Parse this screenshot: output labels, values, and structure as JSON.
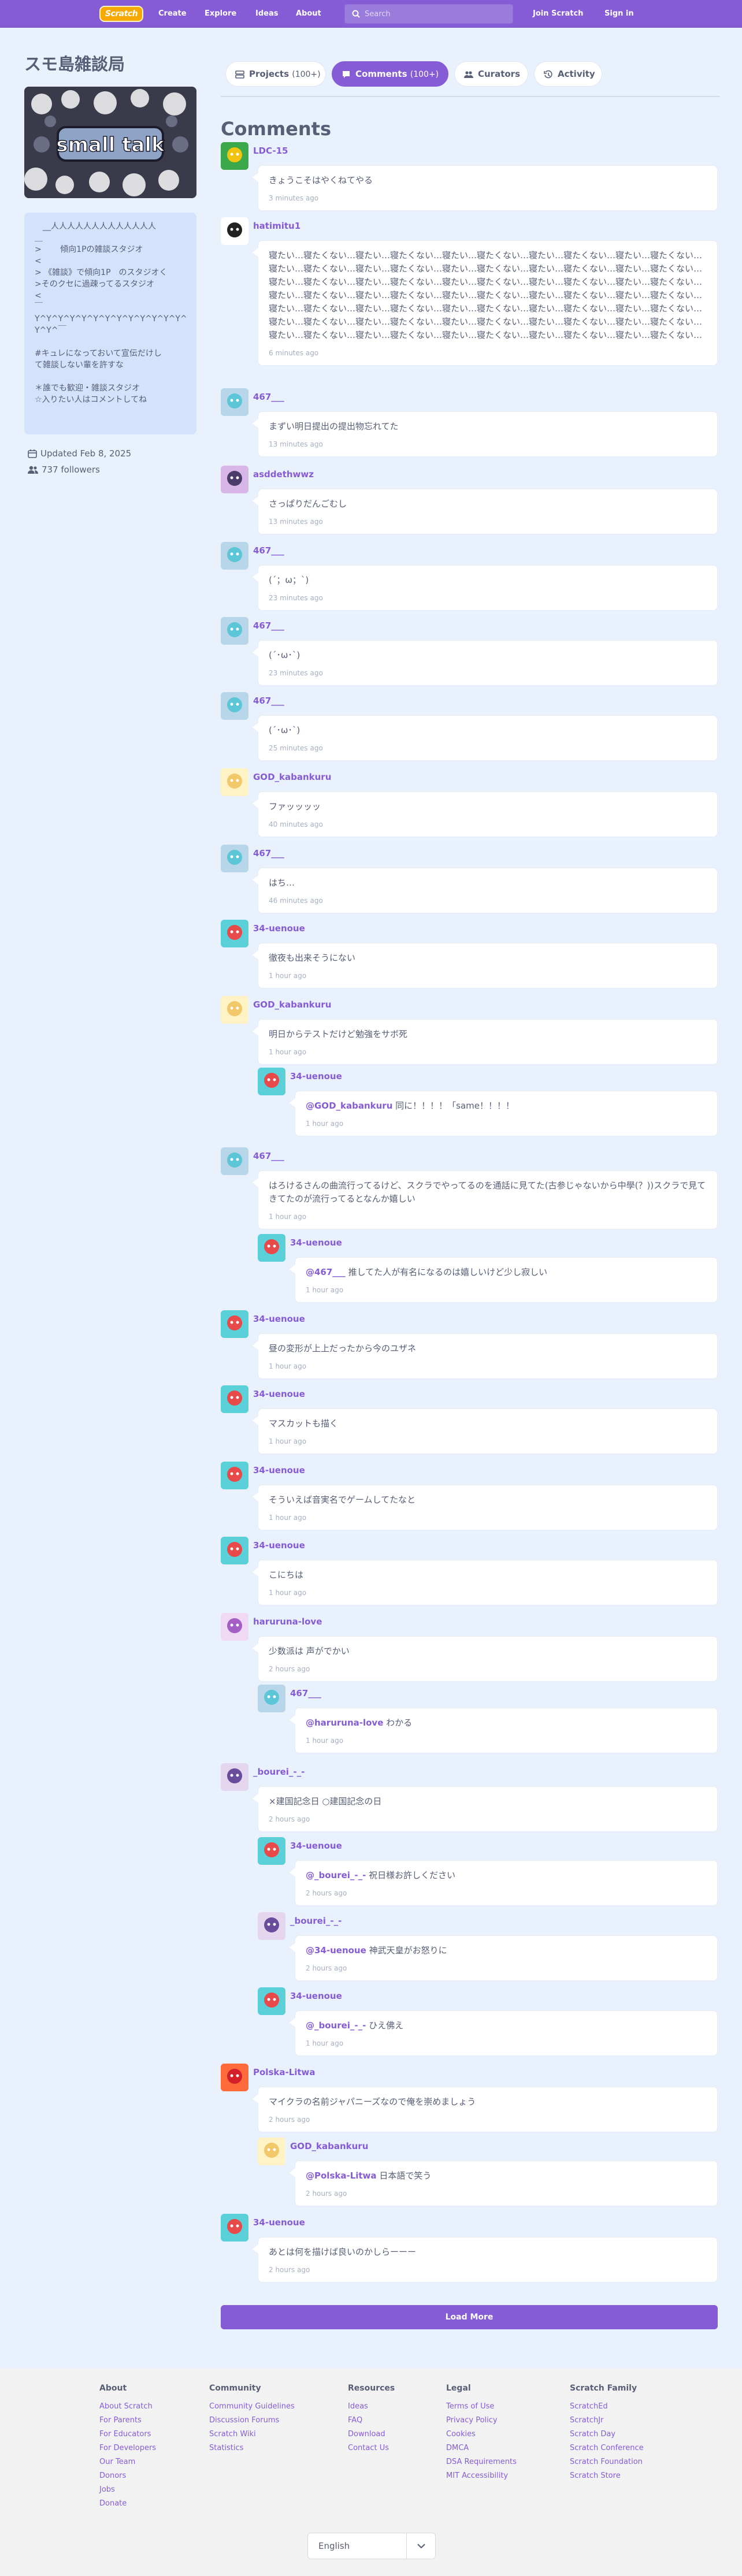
{
  "nav": {
    "logo": "Scratch",
    "create": "Create",
    "explore": "Explore",
    "ideas": "Ideas",
    "about": "About",
    "search_placeholder": "Search",
    "join": "Join Scratch",
    "signin": "Sign in"
  },
  "studio": {
    "title": "スモ島雑談局",
    "thumbnail_text": "small talk",
    "description": "　__人人人人人人人人人人人人人\n＿\n>　　 傾向1Pの雑談スタジオ\n<\n> 《雑談》で傾向1P　のスタジオく\n>そのクセに過疎ってるスタジオ\n<\n￣\nY^Y^Y^Y^Y^Y^Y^Y^Y^Y^Y^Y^Y^\nY^Y^￣\n\n#キュレになっておいて宣伝だけし\nて雑談しない輩を許すな\n\n＊誰でも歓迎・雑談スタジオ\n☆入りたい人はコメントしてね",
    "updated": "Updated Feb 8, 2025",
    "followers": "737 followers"
  },
  "tabs": {
    "projects": "Projects",
    "projects_count": "(100+)",
    "comments": "Comments",
    "comments_count": "(100+)",
    "curators": "Curators",
    "activity": "Activity"
  },
  "comments_heading": "Comments",
  "comments": [
    {
      "author": "LDC-15",
      "text": "きょうこそはやくねてやる",
      "time": "3 minutes ago"
    },
    {
      "author": "hatimitu1",
      "text": "寝たい…寝たくない…寝たい…寝たくない…寝たい…寝たくない…寝たい…寝たくない…寝たい…寝たくない…寝たい…寝たくない…寝たい…寝たくない…寝たい…寝たくない…寝たい…寝たくない…寝たい…寝たくない…寝たい…寝たくない…寝たい…寝たくない…寝たい…寝たくない…寝たい…寝たくない…寝たい…寝たくない…寝たい…寝たくない…寝たい…寝たくない…寝たい…寝たくない…寝たい…寝たくない…寝たい…寝たくない…寝たい…寝たくない…寝たい…寝たくない…寝たい…寝たくない…寝たい…寝たくない…寝たい…寝たくない…寝たい…寝たくない…寝たい…寝たくない…寝たい…寝たくない…寝たい…寝たくない…寝たい…寝たくない…寝たい…寝たくない…寝たい…寝たくない…寝たい…寝たくない…寝たい…寝たくない…寝たい…寝たくない…",
      "time": "6 minutes ago"
    },
    {
      "author": "467___",
      "text": "まずい明日提出の提出物忘れてた",
      "time": "13 minutes ago"
    },
    {
      "author": "asddethwwz",
      "text": "さっぱりだんごむし",
      "time": "13 minutes ago"
    },
    {
      "author": "467___",
      "text": "(´；ω；`)",
      "time": "23 minutes ago"
    },
    {
      "author": "467___",
      "text": "(´･ω･`)",
      "time": "23 minutes ago"
    },
    {
      "author": "467___",
      "text": "(´･ω･`)",
      "time": "25 minutes ago"
    },
    {
      "author": "GOD_kabankuru",
      "text": "ファッッッッ",
      "time": "40 minutes ago"
    },
    {
      "author": "467___",
      "text": "はち…",
      "time": "46 minutes ago"
    },
    {
      "author": "34-uenoue",
      "text": "徹夜も出来そうにない",
      "time": "1 hour ago"
    },
    {
      "author": "GOD_kabankuru",
      "text": "明日からテストだけど勉強をサボ死",
      "time": "1 hour ago"
    },
    {
      "author": "34-uenoue",
      "mention": "@GOD_kabankuru",
      "text": " 同に！！！！「same！！！！",
      "time": "1 hour ago",
      "reply": true
    },
    {
      "author": "467___",
      "text": "はろけるさんの曲流行ってるけど、スクラでやってるのを通話に見てた(古参じゃないから中學(？))スクラで見てきてたのが流行ってるとなんか嬉しい",
      "time": "1 hour ago"
    },
    {
      "author": "34-uenoue",
      "mention": "@467___",
      "text": " 推してた人が有名になるのは嬉しいけど少し寂しい",
      "time": "1 hour ago",
      "reply": true
    },
    {
      "author": "34-uenoue",
      "text": "昼の変形が上上だったから今のユザネ",
      "time": "1 hour ago"
    },
    {
      "author": "34-uenoue",
      "text": "マスカットも描く",
      "time": "1 hour ago"
    },
    {
      "author": "34-uenoue",
      "text": "そういえば音実名でゲームしてたなと",
      "time": "1 hour ago"
    },
    {
      "author": "34-uenoue",
      "text": "こにちは",
      "time": "1 hour ago"
    },
    {
      "author": "haruruna-love",
      "text": "少数派は 声がでかい",
      "time": "2 hours ago"
    },
    {
      "author": "467___",
      "mention": "@haruruna-love",
      "text": " わかる",
      "time": "1 hour ago",
      "reply": true
    },
    {
      "author": "_bourei_-_-",
      "text": "×建国記念日 ○建国記念の日",
      "time": "2 hours ago"
    },
    {
      "author": "34-uenoue",
      "mention": "@_bourei_-_-",
      "text": " 祝日様お許しください",
      "time": "2 hours ago",
      "reply": true
    },
    {
      "author": "_bourei_-_-",
      "mention": "@34-uenoue",
      "text": " 神武天皇がお怒りに",
      "time": "2 hours ago",
      "reply": true
    },
    {
      "author": "34-uenoue",
      "mention": "@_bourei_-_-",
      "text": " ひえ佛え",
      "time": "1 hour ago",
      "reply": true
    },
    {
      "author": "Polska-Litwa",
      "text": "マイクラの名前ジャパニーズなので俺を崇めましょう",
      "time": "2 hours ago"
    },
    {
      "author": "GOD_kabankuru",
      "mention": "@Polska-Litwa",
      "text": " 日本語で笑う",
      "time": "2 hours ago",
      "reply": true
    },
    {
      "author": "34-uenoue",
      "text": "あとは何を描けば良いのかしらーーー",
      "time": "2 hours ago"
    }
  ],
  "load_more": "Load More",
  "footer": {
    "columns": [
      {
        "title": "About",
        "links": [
          "About Scratch",
          "For Parents",
          "For Educators",
          "For Developers",
          "Our Team",
          "Donors",
          "Jobs",
          "Donate"
        ]
      },
      {
        "title": "Community",
        "links": [
          "Community Guidelines",
          "Discussion Forums",
          "Scratch Wiki",
          "Statistics"
        ]
      },
      {
        "title": "Resources",
        "links": [
          "Ideas",
          "FAQ",
          "Download",
          "Contact Us"
        ]
      },
      {
        "title": "Legal",
        "links": [
          "Terms of Use",
          "Privacy Policy",
          "Cookies",
          "DMCA",
          "DSA Requirements",
          "MIT Accessibility"
        ]
      },
      {
        "title": "Scratch Family",
        "links": [
          "ScratchEd",
          "ScratchJr",
          "Scratch Day",
          "Scratch Conference",
          "Scratch Foundation",
          "Scratch Store"
        ]
      }
    ],
    "language": "English"
  },
  "colors": {
    "brand": "#855cd6",
    "page_bg": "#e9f1fc",
    "footer_bg": "#f2f2f2",
    "logo": "#f7a900"
  }
}
